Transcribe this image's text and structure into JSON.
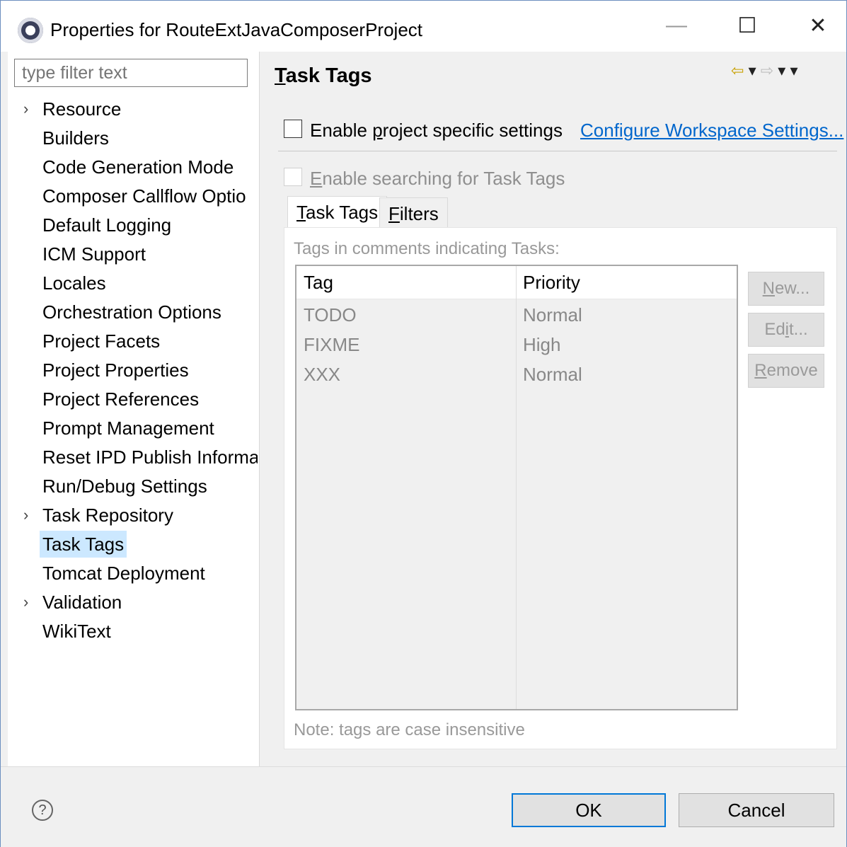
{
  "window": {
    "title": "Properties for RouteExtJavaComposerProject",
    "minimize": "—",
    "maximize": "☐",
    "close": "✕"
  },
  "sidebar": {
    "filter_placeholder": "type filter text",
    "items": [
      {
        "label": "Resource",
        "expandable": true
      },
      {
        "label": "Builders"
      },
      {
        "label": "Code Generation Mode"
      },
      {
        "label": "Composer Callflow Optio"
      },
      {
        "label": "Default Logging"
      },
      {
        "label": "ICM Support"
      },
      {
        "label": "Locales"
      },
      {
        "label": "Orchestration Options"
      },
      {
        "label": "Project Facets"
      },
      {
        "label": "Project Properties"
      },
      {
        "label": "Project References"
      },
      {
        "label": "Prompt Management"
      },
      {
        "label": "Reset IPD Publish Informa"
      },
      {
        "label": "Run/Debug Settings"
      },
      {
        "label": "Task Repository",
        "expandable": true
      },
      {
        "label": "Task Tags",
        "selected": true
      },
      {
        "label": "Tomcat Deployment"
      },
      {
        "label": "Validation",
        "expandable": true
      },
      {
        "label": "WikiText"
      }
    ],
    "scroll_left": "<",
    "scroll_right": ">"
  },
  "page": {
    "title_underlined": "T",
    "title_rest": "ask Tags",
    "nav_back": "⇦",
    "nav_dropdown": "▾",
    "nav_forward": "⇨",
    "nav_menu": "▾",
    "enable_project_pre": "Enable ",
    "enable_project_underlined": "p",
    "enable_project_post": "roject specific settings",
    "configure_link": "Configure Workspace Settings...",
    "enable_searching_underlined": "E",
    "enable_searching_post": "nable searching for Task Tags",
    "tabs": [
      {
        "underlined": "T",
        "rest": "ask Tags",
        "active": true
      },
      {
        "underlined": "F",
        "rest": "ilters",
        "active": false
      }
    ],
    "caption_pre": "Ta",
    "caption_underlined": "g",
    "caption_post": "s in comments indicating Tasks:",
    "table": {
      "headers": [
        "Tag",
        "Priority"
      ],
      "rows": [
        {
          "tag": "TODO",
          "priority": "Normal"
        },
        {
          "tag": "FIXME",
          "priority": "High"
        },
        {
          "tag": "XXX",
          "priority": "Normal"
        }
      ]
    },
    "buttons": {
      "new_underlined": "N",
      "new_rest": "ew...",
      "edit_pre": "Ed",
      "edit_underlined": "i",
      "edit_post": "t...",
      "remove_underlined": "R",
      "remove_rest": "emove"
    },
    "note": "Note: tags are case insensitive"
  },
  "footer": {
    "help": "?",
    "ok": "OK",
    "cancel": "Cancel"
  },
  "colors": {
    "selection": "#cce8ff",
    "link": "#0066cc",
    "default_button_border": "#0078d7"
  }
}
